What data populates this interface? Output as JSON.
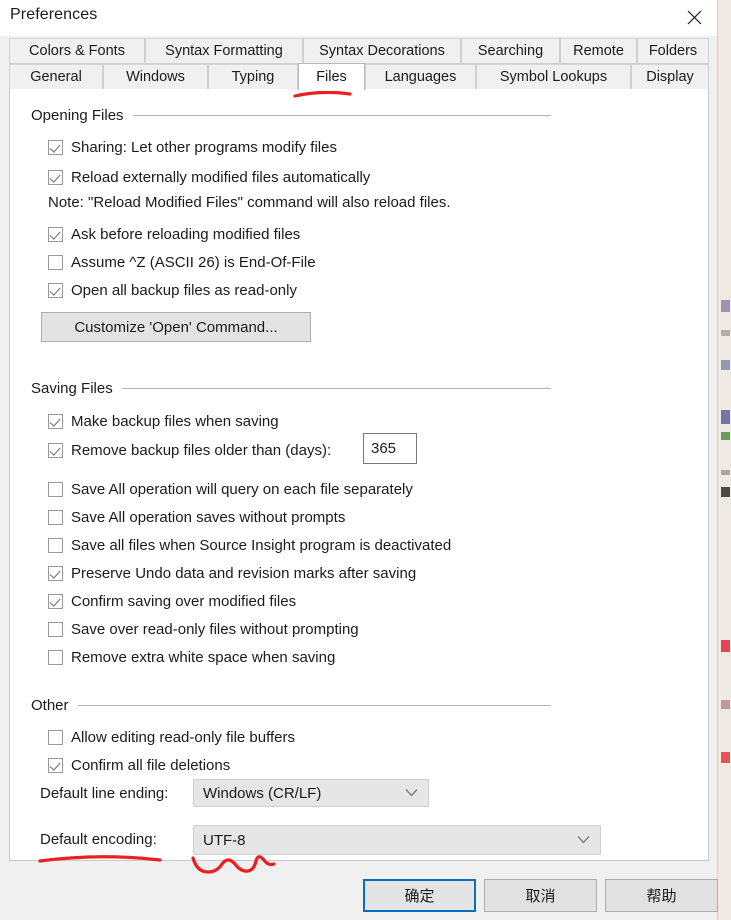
{
  "window": {
    "title": "Preferences",
    "close_icon": "close-icon"
  },
  "tabs": {
    "row1": [
      {
        "label": "Colors & Fonts",
        "selected": false
      },
      {
        "label": "Syntax Formatting",
        "selected": false
      },
      {
        "label": "Syntax Decorations",
        "selected": false
      },
      {
        "label": "Searching",
        "selected": false
      },
      {
        "label": "Remote",
        "selected": false
      },
      {
        "label": "Folders",
        "selected": false
      }
    ],
    "row2": [
      {
        "label": "General",
        "selected": false
      },
      {
        "label": "Windows",
        "selected": false
      },
      {
        "label": "Typing",
        "selected": false
      },
      {
        "label": "Files",
        "selected": true
      },
      {
        "label": "Languages",
        "selected": false
      },
      {
        "label": "Symbol Lookups",
        "selected": false
      },
      {
        "label": "Display",
        "selected": false
      }
    ]
  },
  "sections": {
    "opening_files": {
      "title": "Opening Files",
      "checkboxes": [
        {
          "label": "Sharing: Let other programs modify files",
          "checked": true
        },
        {
          "label": "Reload externally modified files automatically",
          "checked": true
        },
        {
          "label": "Ask before reloading modified files",
          "checked": true
        },
        {
          "label": "Assume ^Z (ASCII 26) is End-Of-File",
          "checked": false
        },
        {
          "label": "Open all backup files as read-only",
          "checked": true
        }
      ],
      "note": "Note: \"Reload Modified Files\" command will also reload files.",
      "customize_button": "Customize 'Open' Command..."
    },
    "saving_files": {
      "title": "Saving Files",
      "checkboxes": [
        {
          "label": "Make backup files when saving",
          "checked": true
        },
        {
          "label": "Remove backup files older than (days):",
          "checked": true
        },
        {
          "label": "Save All operation will query on each file separately",
          "checked": false
        },
        {
          "label": "Save All operation saves without prompts",
          "checked": false
        },
        {
          "label": "Save all files when Source Insight program is deactivated",
          "checked": false
        },
        {
          "label": "Preserve Undo data and revision marks after saving",
          "checked": true
        },
        {
          "label": "Confirm saving over modified files",
          "checked": true
        },
        {
          "label": "Save over read-only files without prompting",
          "checked": false
        },
        {
          "label": "Remove extra white space when saving",
          "checked": false
        }
      ],
      "backup_days_value": "365"
    },
    "other": {
      "title": "Other",
      "checkboxes": [
        {
          "label": "Allow editing read-only file buffers",
          "checked": false
        },
        {
          "label": "Confirm all file deletions",
          "checked": true
        }
      ],
      "line_ending_label": "Default line ending:",
      "line_ending_value": "Windows (CR/LF)",
      "encoding_label": "Default encoding:",
      "encoding_value": "UTF-8"
    }
  },
  "footer": {
    "ok_label": "确定",
    "cancel_label": "取消",
    "help_label": "帮助"
  },
  "annotations": {
    "ink_color": "#e8201f",
    "marks": [
      "underline-files-tab",
      "underline-default-encoding-label",
      "squiggle-under-encoding-dropdown"
    ]
  }
}
